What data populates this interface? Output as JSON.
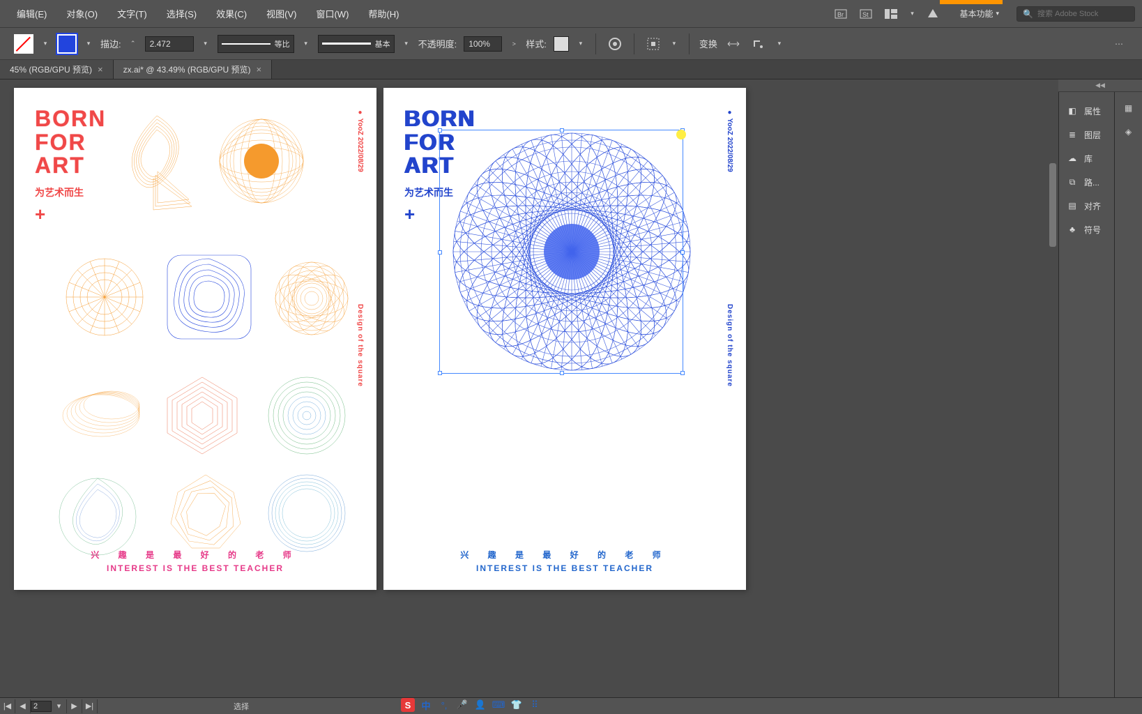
{
  "menu": {
    "edit": "编辑(E)",
    "object": "对象(O)",
    "text": "文字(T)",
    "select": "选择(S)",
    "effect": "效果(C)",
    "view": "视图(V)",
    "window": "窗口(W)",
    "help": "帮助(H)"
  },
  "workspace": {
    "label": "基本功能"
  },
  "search": {
    "placeholder": "搜索 Adobe Stock"
  },
  "optbar": {
    "stroke_label": "描边:",
    "stroke_val": "2.472",
    "profile1": "等比",
    "profile2": "基本",
    "opacity_label": "不透明度:",
    "opacity_val": "100%",
    "style_label": "样式:",
    "transform_label": "变换"
  },
  "tabs": [
    {
      "label": "45% (RGB/GPU 预览)"
    },
    {
      "label": "zx.ai* @ 43.49% (RGB/GPU 预览)"
    }
  ],
  "panels": {
    "properties": "属性",
    "layers": "图层",
    "libraries": "库",
    "pathfinder": "路...",
    "align": "对齐",
    "symbols": "符号"
  },
  "status": {
    "artboard": "2",
    "tool": "选择"
  },
  "ime": {
    "logo": "S",
    "lang": "中"
  },
  "art": {
    "title_l1": "BORN",
    "title_l2": "FOR",
    "title_l3": "ART",
    "subtitle": "为艺术而生",
    "plus": "+",
    "side1": "● YooZ  2022/08/29",
    "side2": "Design of the square",
    "footer_cn": "兴 趣 是 最 好 的 老 师",
    "footer_en": "INTEREST IS THE BEST TEACHER"
  }
}
